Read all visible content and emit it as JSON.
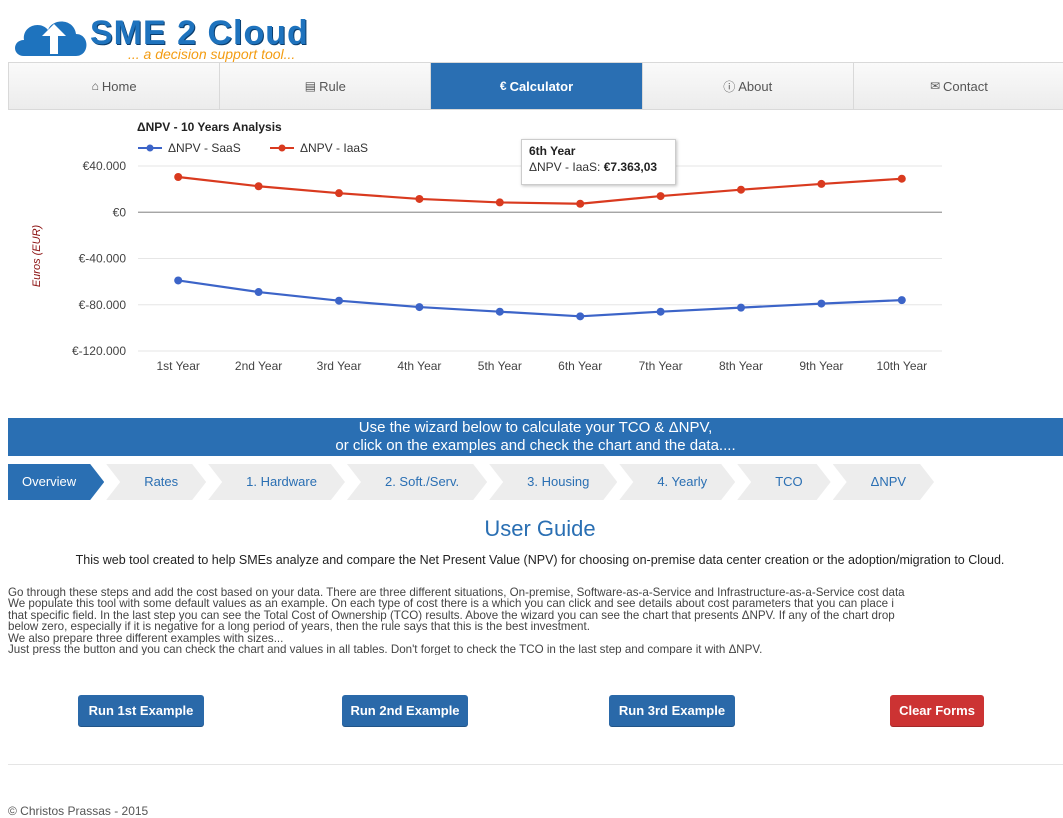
{
  "brand": {
    "title": "SME 2 Cloud",
    "subtitle": "... a decision support tool..."
  },
  "nav": [
    {
      "icon": "home-icon",
      "label": "Home",
      "active": false
    },
    {
      "icon": "rule-icon",
      "label": "Rule",
      "active": false
    },
    {
      "icon": "euro-icon",
      "label": "Calculator",
      "active": true
    },
    {
      "icon": "info-icon",
      "label": "About",
      "active": false
    },
    {
      "icon": "mail-icon",
      "label": "Contact",
      "active": false
    }
  ],
  "chart_data": {
    "type": "line",
    "title": "ΔNPV - 10 Years Analysis",
    "xlabel": "",
    "ylabel": "Euros (EUR)",
    "categories": [
      "1st Year",
      "2nd Year",
      "3rd Year",
      "4th Year",
      "5th Year",
      "6th Year",
      "7th Year",
      "8th Year",
      "9th Year",
      "10th Year"
    ],
    "ylim": [
      -120000,
      40000
    ],
    "yticks": [
      "€40.000",
      "€0",
      "€-40.000",
      "€-80.000",
      "€-120.000"
    ],
    "legend": "top-left",
    "series": [
      {
        "name": "ΔNPV - SaaS",
        "color": "#3c64c8",
        "values": [
          -59000,
          -69000,
          -76500,
          -82000,
          -86000,
          -90000,
          -86000,
          -82500,
          -79000,
          -76000
        ]
      },
      {
        "name": "ΔNPV - IaaS",
        "color": "#d93a1f",
        "values": [
          30500,
          22500,
          16500,
          11500,
          8500,
          7363.03,
          14000,
          19500,
          24500,
          29000
        ]
      }
    ],
    "tooltip": {
      "title": "6th Year",
      "label": "ΔNPV - IaaS:",
      "value": "€7.363,03"
    }
  },
  "banner": {
    "line1": "Use the wizard below to calculate your TCO & ΔNPV,",
    "line2": "or click on the examples and check the chart and the data...."
  },
  "steps": [
    "Overview",
    "Rates",
    "1. Hardware",
    "2. Soft./Serv.",
    "3. Housing",
    "4. Yearly",
    "TCO",
    "ΔNPV"
  ],
  "guide": {
    "title": "User Guide",
    "lead": "This web tool created to help SMEs analyze and compare the Net Present Value (NPV) for choosing on-premise data center creation or the adoption/migration to Cloud.",
    "lines": [
      "Go through these steps and add the cost based on your data. There are three different situations, On-premise, Software-as-a-Service and Infrastructure-as-a-Service cost data",
      "We populate this tool with some default values as an example. On each type of cost there is a which you can click and see details about cost parameters that you can place i",
      "that specific field. In the last step you can see the Total Cost of Ownership (TCO) results. Above the wizard you can see the chart that presents ΔNPV. If any of the chart drop",
      "below zero, especially if it is negative for a long period of years, then the rule says that this is the best investment.",
      "We also prepare three different examples with sizes...",
      "Just press the button and you can check the chart and values in all tables. Don't forget to check the TCO in the last step and compare it with ΔNPV."
    ]
  },
  "buttons": {
    "ex1": "Run 1st Example",
    "ex2": "Run 2nd Example",
    "ex3": "Run 3rd Example",
    "clear": "Clear Forms"
  },
  "footer": "© Christos Prassas - 2015"
}
